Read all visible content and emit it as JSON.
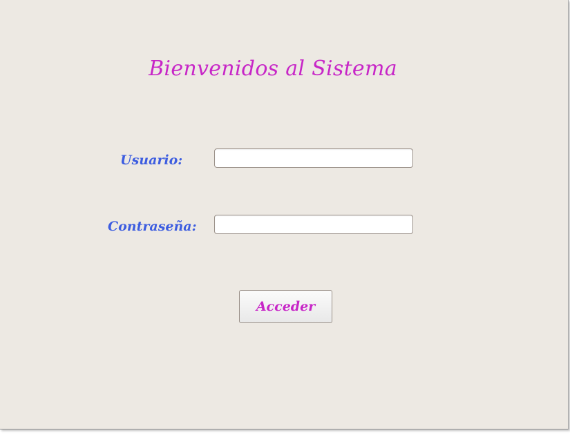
{
  "login": {
    "title": "Bienvenidos al Sistema",
    "username_label": "Usuario:",
    "username_value": "",
    "password_label": "Contraseña:",
    "password_value": "",
    "submit_label": "Acceder"
  },
  "colors": {
    "background": "#ede9e3",
    "title": "#c726c7",
    "labels": "#3d5de0",
    "button_text": "#c726c7"
  }
}
